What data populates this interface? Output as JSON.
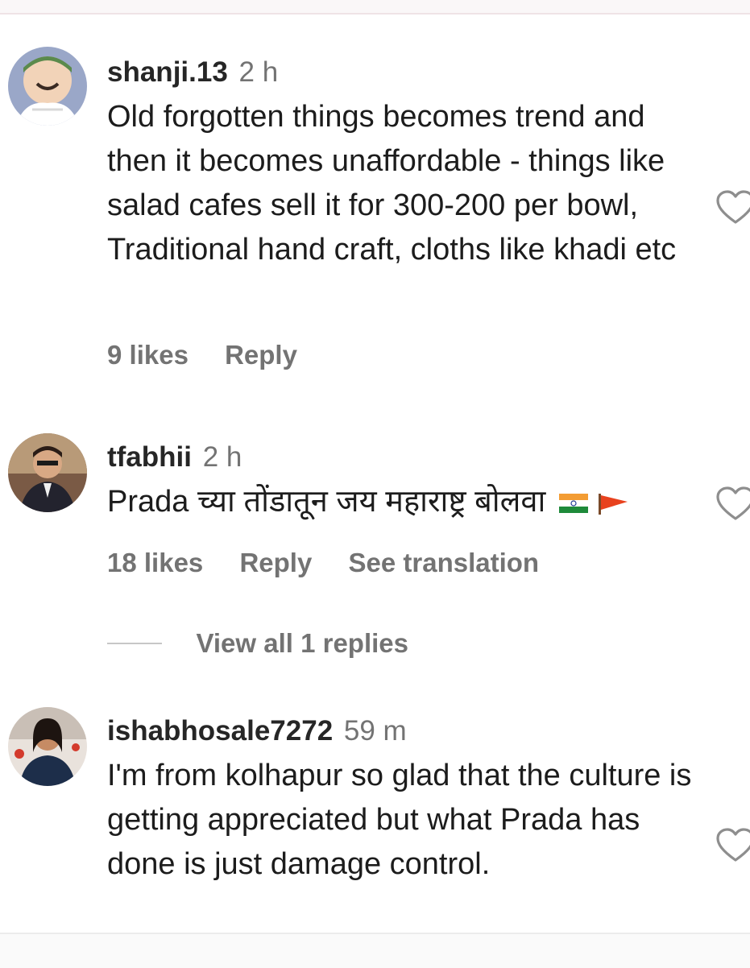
{
  "comments": [
    {
      "username": "shanji.13",
      "time": "2 h",
      "text": "Old forgotten things becomes trend and then it becomes unaffordable - things like salad cafes sell it for 300-200 per bowl, Traditional hand craft, cloths like khadi etc",
      "likes": "9 likes",
      "reply": "Reply"
    },
    {
      "username": "tfabhii",
      "time": "2 h",
      "text": "Prada च्या तोंडातून जय महाराष्ट्र बोलवा",
      "emoji": [
        "india-flag",
        "saffron-flag"
      ],
      "likes": "18 likes",
      "reply": "Reply",
      "translate": "See translation",
      "view_replies": "View all 1 replies"
    },
    {
      "username": "ishabhosale7272",
      "time": "59 m",
      "text": "I'm from kolhapur so glad that the culture is getting appreciated but what Prada has done is just damage control."
    }
  ],
  "icons": {
    "like": "heart-outline-icon"
  },
  "colors": {
    "primary_text": "#262626",
    "secondary_text": "#737373",
    "heart_stroke": "#8e8e8e"
  }
}
